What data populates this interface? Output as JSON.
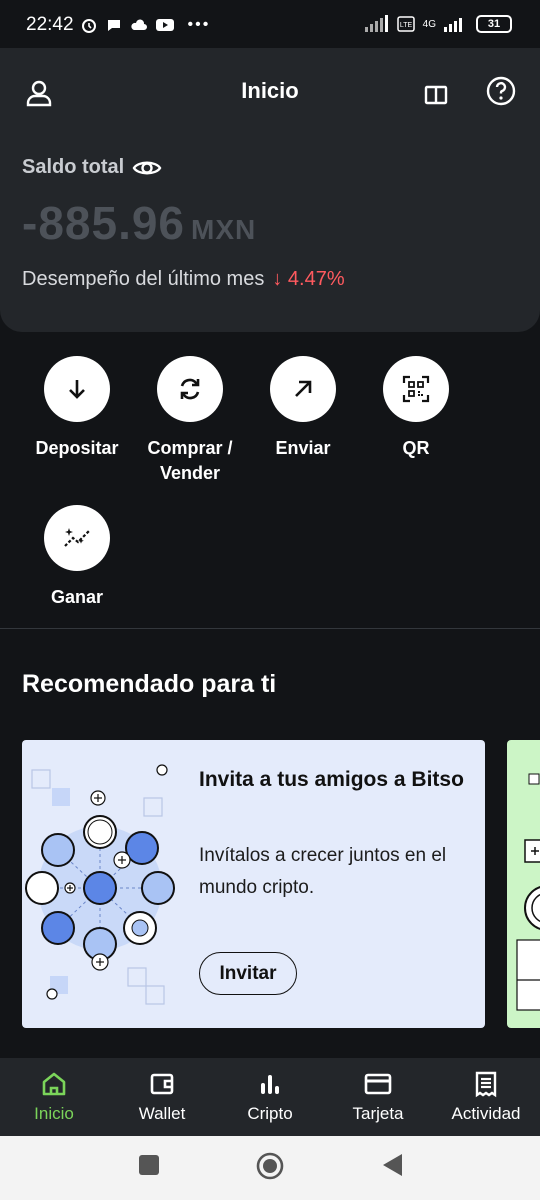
{
  "status": {
    "time": "22:42",
    "battery": "31",
    "network": "4G"
  },
  "header": {
    "title": "Inicio"
  },
  "balance": {
    "label": "Saldo total",
    "amount": "-885.96",
    "currency": "MXN",
    "performance_label": "Desempeño del último mes",
    "performance_value": "↓ 4.47%"
  },
  "actions": [
    {
      "label": "Depositar",
      "icon": "arrow-down-icon"
    },
    {
      "label": "Comprar /\nVender",
      "icon": "exchange-icon"
    },
    {
      "label": "Enviar",
      "icon": "arrow-up-right-icon"
    },
    {
      "label": "QR",
      "icon": "qr-icon"
    },
    {
      "label": "Ganar",
      "icon": "sparkle-chart-icon"
    }
  ],
  "recommended": {
    "title": "Recomendado para ti",
    "card": {
      "title": "Invita a tus amigos a Bitso",
      "description": "Invítalos a crecer juntos en el mundo cripto.",
      "button": "Invitar"
    }
  },
  "bottom_nav": [
    {
      "label": "Inicio",
      "icon": "home-icon",
      "active": true
    },
    {
      "label": "Wallet",
      "icon": "wallet-icon",
      "active": false
    },
    {
      "label": "Cripto",
      "icon": "bar-chart-icon",
      "active": false
    },
    {
      "label": "Tarjeta",
      "icon": "card-icon",
      "active": false
    },
    {
      "label": "Actividad",
      "icon": "receipt-icon",
      "active": false
    }
  ],
  "colors": {
    "accent_green": "#7bd45a",
    "negative": "#ff5a5f",
    "card_bg": "#e4ebfb"
  }
}
